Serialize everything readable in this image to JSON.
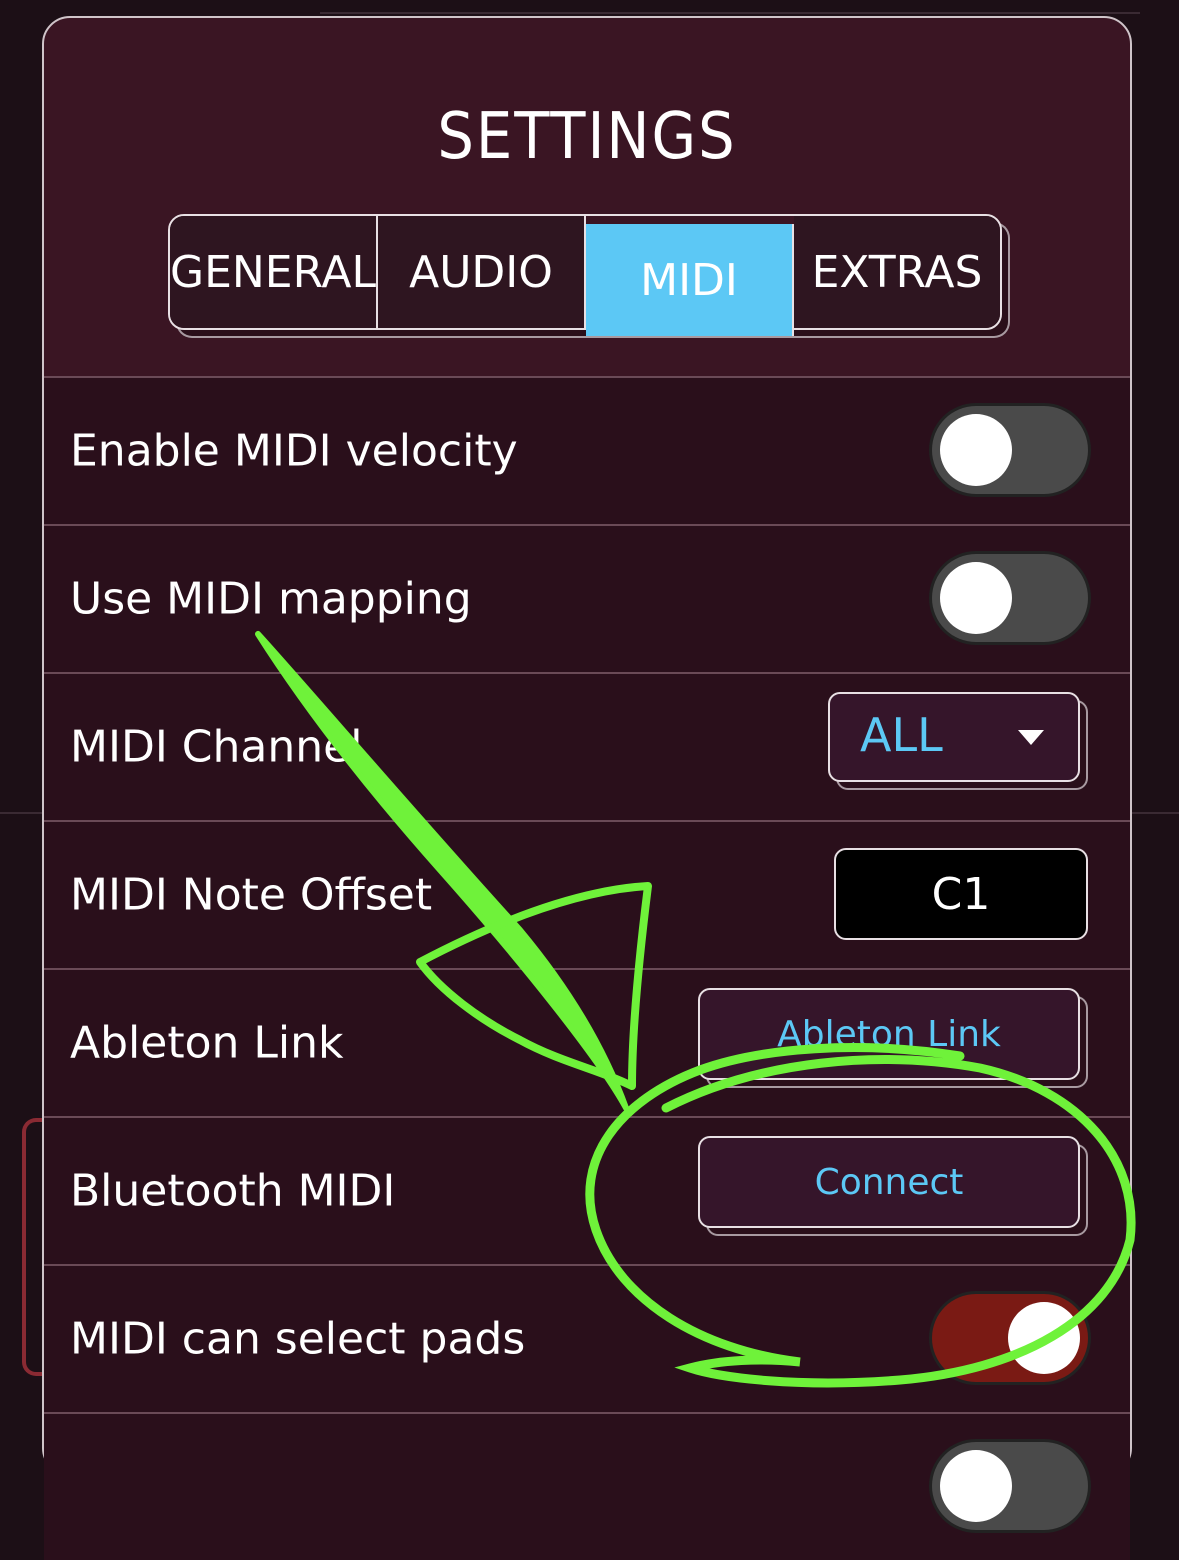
{
  "settings": {
    "title": "SETTINGS",
    "tabs": [
      {
        "label": "GENERAL"
      },
      {
        "label": "AUDIO"
      },
      {
        "label": "MIDI"
      },
      {
        "label": "EXTRAS"
      }
    ],
    "active_tab": "MIDI"
  },
  "rows": {
    "midi_velocity": {
      "label": "Enable MIDI velocity",
      "state": "off"
    },
    "midi_mapping": {
      "label": "Use MIDI mapping",
      "state": "off"
    },
    "midi_channel": {
      "label": "MIDI Channel",
      "value": "ALL"
    },
    "note_offset": {
      "label": "MIDI Note Offset",
      "value": "C1"
    },
    "ableton_link": {
      "label": "Ableton Link",
      "button": "Ableton Link"
    },
    "bluetooth_midi": {
      "label": "Bluetooth MIDI",
      "button": "Connect"
    },
    "select_pads": {
      "label": "MIDI can select pads",
      "state": "on"
    }
  },
  "colors": {
    "accent": "#5cc8f5",
    "panel": "#3a1523",
    "toggle_on": "#7a1a14",
    "annotation": "#6ff23a"
  }
}
